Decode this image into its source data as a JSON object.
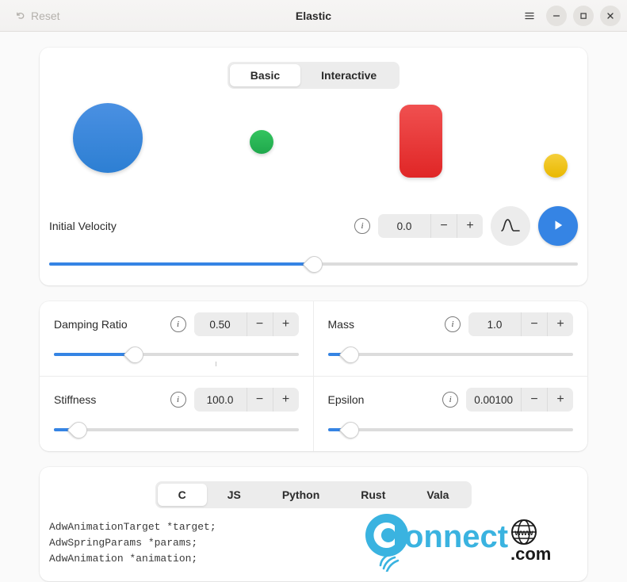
{
  "titlebar": {
    "reset_label": "Reset",
    "reset_icon": "undo-icon",
    "title": "Elastic",
    "menu_icon": "hamburger-menu-icon",
    "minimize_icon": "minimize-icon",
    "maximize_icon": "maximize-icon",
    "close_icon": "close-icon"
  },
  "demo": {
    "tabs": [
      {
        "label": "Basic",
        "active": true
      },
      {
        "label": "Interactive",
        "active": false
      }
    ],
    "shapes": [
      {
        "name": "blue-circle",
        "color": "#3584e4"
      },
      {
        "name": "green-circle",
        "color": "#2ec27e"
      },
      {
        "name": "red-rounded-rect",
        "color": "#e01b24"
      },
      {
        "name": "yellow-circle",
        "color": "#f0c814"
      }
    ],
    "velocity": {
      "label": "Initial Velocity",
      "info_icon": "info-icon",
      "value": "0.0",
      "minus": "−",
      "plus": "+",
      "slider_percent": 50,
      "curve_button_icon": "spring-curve-icon",
      "play_button_icon": "play-icon"
    }
  },
  "params": {
    "damping": {
      "label": "Damping Ratio",
      "info_icon": "info-icon",
      "value": "0.50",
      "minus": "−",
      "plus": "+",
      "slider_percent": 33,
      "mark_percent": 66
    },
    "mass": {
      "label": "Mass",
      "info_icon": "info-icon",
      "value": "1.0",
      "minus": "−",
      "plus": "+",
      "slider_percent": 9
    },
    "stiffness": {
      "label": "Stiffness",
      "info_icon": "info-icon",
      "value": "100.0",
      "minus": "−",
      "plus": "+",
      "slider_percent": 10
    },
    "epsilon": {
      "label": "Epsilon",
      "info_icon": "info-icon",
      "value": "0.00100",
      "minus": "−",
      "plus": "+",
      "slider_percent": 9
    }
  },
  "code": {
    "tabs": [
      {
        "label": "C",
        "active": true
      },
      {
        "label": "JS",
        "active": false
      },
      {
        "label": "Python",
        "active": false
      },
      {
        "label": "Rust",
        "active": false
      },
      {
        "label": "Vala",
        "active": false
      }
    ],
    "snippet": "AdwAnimationTarget *target;\nAdwSpringParams *params;\nAdwAnimation *animation;"
  },
  "watermark": {
    "text_connect": "Connect",
    "text_www": "www",
    "text_com": ".com",
    "color": "#3ab3e0"
  },
  "colors": {
    "accent": "#3584e4",
    "window_bg": "#fafafa",
    "card_bg": "#ffffff",
    "titlebar_bg": "#f6f5f4"
  }
}
